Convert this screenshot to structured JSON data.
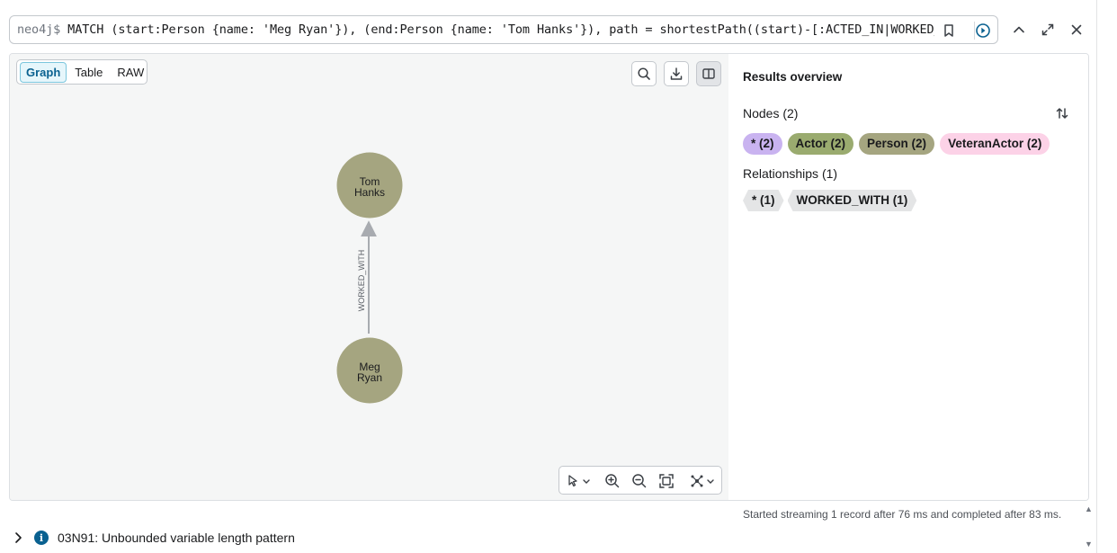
{
  "query": {
    "prompt": "neo4j$",
    "text": "MATCH (start:Person {name: 'Meg Ryan'}), (end:Person {name: 'Tom Hanks'}), path = shortestPath((start)-[:ACTED_IN|WORKED_WITH*]-(end)) RETURN path"
  },
  "view_tabs": [
    "Graph",
    "Table",
    "RAW"
  ],
  "active_view": "Graph",
  "graph": {
    "nodes": [
      {
        "label_line1": "Tom",
        "label_line2": "Hanks",
        "color": "#a5a580"
      },
      {
        "label_line1": "Meg",
        "label_line2": "Ryan",
        "color": "#a5a580"
      }
    ],
    "relationship": {
      "type": "WORKED_WITH",
      "color": "#a8abb0"
    }
  },
  "overview": {
    "title": "Results overview",
    "nodes_heading": "Nodes (2)",
    "node_chips": [
      {
        "label": "* (2)",
        "color": "#c9b3f0"
      },
      {
        "label": "Actor (2)",
        "color": "#9aab6f"
      },
      {
        "label": "Person (2)",
        "color": "#a5a580"
      },
      {
        "label": "VeteranActor (2)",
        "color": "#fcd2e7"
      }
    ],
    "relationships_heading": "Relationships (1)",
    "rel_chips": [
      {
        "label": "* (1)"
      },
      {
        "label": "WORKED_WITH (1)"
      }
    ]
  },
  "status": "Started streaming 1 record after 76 ms and completed after 83 ms.",
  "notice": {
    "code_text": "03N91: Unbounded variable length pattern"
  }
}
